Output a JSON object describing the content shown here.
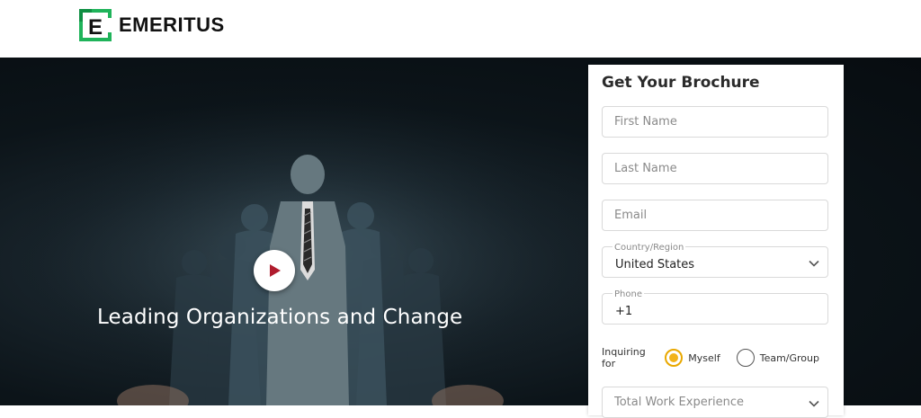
{
  "header": {
    "logo_letter": "E",
    "logo_text": "EMERITUS",
    "brand_color": "#1db954"
  },
  "hero": {
    "title": "Leading Organizations and Change",
    "play_icon": "play-icon",
    "play_color": "#b01c2e"
  },
  "form": {
    "title": "Get Your Brochure",
    "first_name_placeholder": "First Name",
    "last_name_placeholder": "Last Name",
    "email_placeholder": "Email",
    "country_label": "Country/Region",
    "country_value": "United States",
    "phone_label": "Phone",
    "phone_value": "+1",
    "inquiring_label": "Inquiring for",
    "option_myself": "Myself",
    "option_team": "Team/Group",
    "selected_option": "Myself",
    "work_experience_placeholder": "Total Work Experience",
    "accent_color": "#f2b31a"
  }
}
